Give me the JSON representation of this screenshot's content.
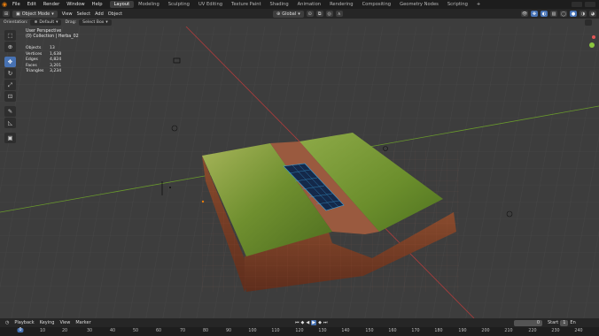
{
  "topbar": {
    "menus": [
      "File",
      "Edit",
      "Render",
      "Window",
      "Help"
    ],
    "workspaces": [
      "Layout",
      "Modeling",
      "Sculpting",
      "UV Editing",
      "Texture Paint",
      "Shading",
      "Animation",
      "Rendering",
      "Compositing",
      "Geometry Nodes",
      "Scripting"
    ],
    "active_workspace": "Layout",
    "add_tab": "+"
  },
  "header": {
    "mode": "Object Mode",
    "menus": [
      "View",
      "Select",
      "Add",
      "Object"
    ],
    "transform": "Global"
  },
  "toolopts": {
    "orientation_label": "Orientation:",
    "orientation_value": "Default",
    "drag_label": "Drag:",
    "drag_value": "Select Box"
  },
  "overlay": {
    "view_name": "User Perspective",
    "collection": "(0) Collection | Herba_02",
    "stats": [
      {
        "label": "Objects",
        "value": "13"
      },
      {
        "label": "Vertices",
        "value": "1,638"
      },
      {
        "label": "Edges",
        "value": "4,824"
      },
      {
        "label": "Faces",
        "value": "3,201"
      },
      {
        "label": "Triangles",
        "value": "3,234"
      }
    ]
  },
  "timeline": {
    "menus": [
      "Playback",
      "Keying",
      "View",
      "Marker"
    ],
    "current_frame": "0",
    "start_label": "Start",
    "start_value": "1",
    "end_label": "En",
    "ruler": [
      "0",
      "10",
      "20",
      "30",
      "40",
      "50",
      "60",
      "70",
      "80",
      "90",
      "100",
      "110",
      "120",
      "130",
      "140",
      "150",
      "160",
      "170",
      "180",
      "190",
      "200",
      "210",
      "220",
      "230",
      "240"
    ]
  },
  "colors": {
    "accent": "#4772b3",
    "x_axis": "#b33c3c",
    "y_axis": "#6a9b2c",
    "grass": "#7f9e3a",
    "soil": "#7a3d24",
    "logo": "#e87d0d"
  },
  "icons": {
    "logo": "blender-logo-icon",
    "tools": [
      "select-box-icon",
      "cursor-icon",
      "move-icon",
      "rotate-icon",
      "scale-icon",
      "transform-icon",
      "annotate-icon",
      "measure-icon",
      "add-cube-icon"
    ]
  }
}
